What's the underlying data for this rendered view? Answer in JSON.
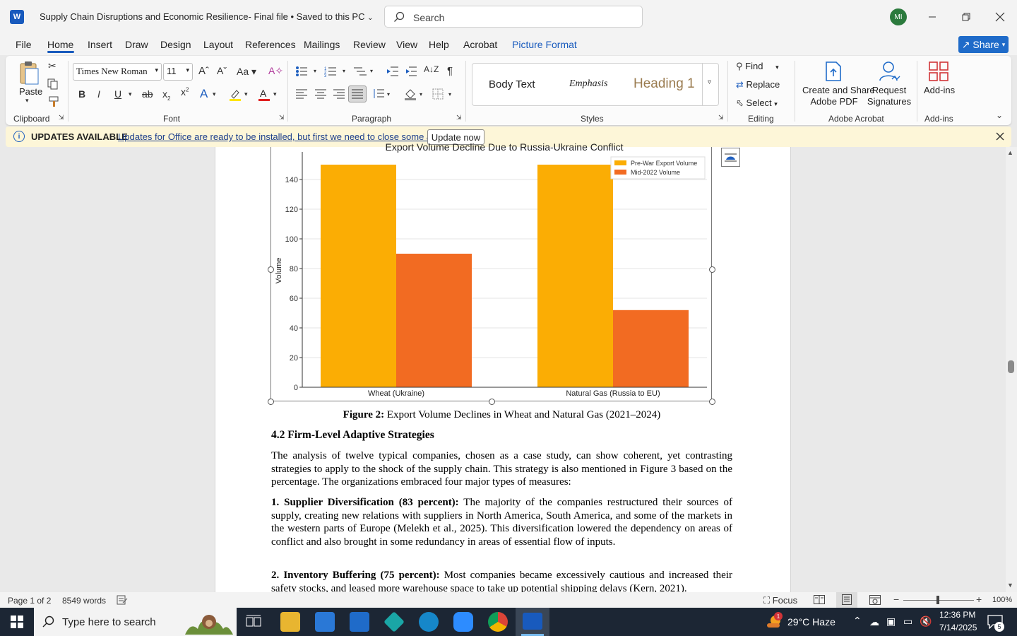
{
  "window": {
    "title": "Supply Chain Disruptions and Economic Resilience- Final file  •  Saved to this PC",
    "search_placeholder": "Search",
    "avatar_initials": "MI"
  },
  "menu": {
    "tabs": [
      "File",
      "Home",
      "Insert",
      "Draw",
      "Design",
      "Layout",
      "References",
      "Mailings",
      "Review",
      "View",
      "Help",
      "Acrobat",
      "Picture Format"
    ],
    "active": "Home",
    "share": "Share"
  },
  "ribbon": {
    "clipboard": {
      "paste": "Paste",
      "label": "Clipboard"
    },
    "font": {
      "name": "Times New Roman",
      "size": "11",
      "label": "Font"
    },
    "paragraph": {
      "label": "Paragraph"
    },
    "styles": {
      "items": [
        "Body Text",
        "Emphasis",
        "Heading 1"
      ],
      "label": "Styles"
    },
    "editing": {
      "find": "Find",
      "replace": "Replace",
      "select": "Select",
      "label": "Editing"
    },
    "acrobat": {
      "create": "Create and Share",
      "create2": "Adobe PDF",
      "request": "Request",
      "request2": "Signatures",
      "label": "Adobe Acrobat"
    },
    "addins": {
      "button": "Add-ins",
      "label": "Add-ins"
    }
  },
  "update_bar": {
    "title": "UPDATES AVAILABLE",
    "message": "Updates for Office are ready to be installed, but first we need to close some apps.",
    "button": "Update now"
  },
  "chart_data": {
    "type": "bar",
    "title": "Export Volume Decline Due to Russia-Ukraine Conflict",
    "categories": [
      "Wheat (Ukraine)",
      "Natural Gas (Russia to EU)"
    ],
    "series": [
      {
        "name": "Pre-War Export Volume",
        "values": [
          150,
          150
        ],
        "color": "#fbad04"
      },
      {
        "name": "Mid-2022 Volume",
        "values": [
          90,
          52
        ],
        "color": "#f26b22"
      }
    ],
    "ylabel": "Volume",
    "ylim": [
      0,
      160
    ],
    "yticks": [
      "0",
      "20",
      "40",
      "60",
      "80",
      "100",
      "120",
      "140"
    ],
    "grid": true,
    "legend": "top-right"
  },
  "document": {
    "caption_bold": "Figure 2:",
    "caption_text": " Export Volume Declines in Wheat and Natural Gas (2021–2024)",
    "heading": "4.2 Firm-Level Adaptive Strategies",
    "para1": "The analysis of twelve typical companies, chosen as a case study, can show coherent, yet contrasting strategies to apply to the shock of the supply chain. This strategy is also mentioned in Figure 3 based on the percentage. The organizations embraced four major types of measures:",
    "item1_bold": "1. Supplier Diversification (83 percent):",
    "item1_text": " The majority of the companies restructured their sources of supply, creating new relations with suppliers in North America, South America, and some of the markets in the western parts of Europe (Melekh et al., 2025). This diversification lowered the dependency on areas of conflict and also brought in some redundancy in areas of essential flow of inputs.",
    "item2_bold": "2. Inventory Buffering (75 percent):",
    "item2_text": " Most companies became excessively cautious and increased their safety stocks, and leased more warehouse space to take up potential shipping delays (Kern, 2021)."
  },
  "status": {
    "page": "Page 1 of 2",
    "words": "8549 words",
    "focus": "Focus",
    "zoom": "100%"
  },
  "taskbar": {
    "search": "Type here to search",
    "weather": "29°C  Haze",
    "time": "12:36 PM",
    "date": "7/14/2025",
    "notifications": "5",
    "weather_badge": "1"
  }
}
